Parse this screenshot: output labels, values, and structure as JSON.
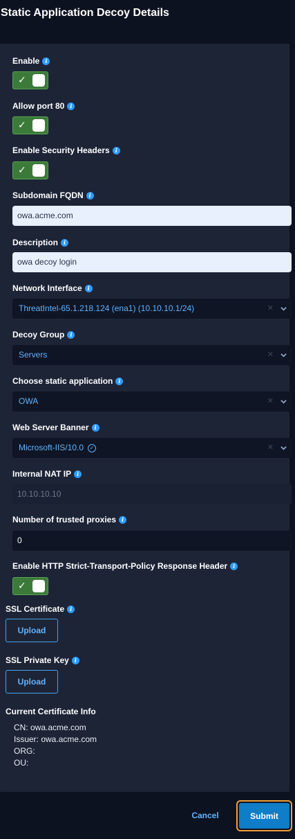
{
  "title": "Static Application Decoy Details",
  "fields": {
    "enable": {
      "label": "Enable",
      "checked": true
    },
    "allow_port_80": {
      "label": "Allow port 80",
      "checked": true
    },
    "enable_security_headers": {
      "label": "Enable Security Headers",
      "checked": true
    },
    "subdomain_fqdn": {
      "label": "Subdomain FQDN",
      "value": "owa.acme.com"
    },
    "description": {
      "label": "Description",
      "value": "owa decoy login"
    },
    "network_interface": {
      "label": "Network Interface",
      "value": "ThreatIntel-65.1.218.124 (ena1) (10.10.10.1/24)"
    },
    "decoy_group": {
      "label": "Decoy Group",
      "value": "Servers"
    },
    "static_application": {
      "label": "Choose static application",
      "value": "OWA"
    },
    "web_server_banner": {
      "label": "Web Server Banner",
      "value": "Microsoft-IIS/10.0"
    },
    "internal_nat_ip": {
      "label": "Internal NAT IP",
      "value": "10.10.10.10"
    },
    "trusted_proxies": {
      "label": "Number of trusted proxies",
      "value": "0"
    },
    "hsts_header": {
      "label": "Enable HTTP Strict-Transport-Policy Response Header",
      "checked": true
    }
  },
  "ssl_certificate": {
    "label": "SSL Certificate",
    "button": "Upload"
  },
  "ssl_private_key": {
    "label": "SSL Private Key",
    "button": "Upload"
  },
  "cert_info": {
    "title": "Current Certificate Info",
    "cn": "CN: owa.acme.com",
    "issuer": "Issuer: owa.acme.com",
    "org": "ORG:",
    "ou": "OU:"
  },
  "actions": {
    "cancel": "Cancel",
    "submit": "Submit"
  },
  "icons": {
    "info": "info-icon",
    "check": "check-icon",
    "chevron": "chevron-down-icon",
    "clear": "clear-icon",
    "verified": "check-circle-icon"
  },
  "colors": {
    "accent": "#2f9bff",
    "toggle_on": "#3c7a3a",
    "submit": "#0f7dc7",
    "focus_ring": "#f29f38"
  }
}
